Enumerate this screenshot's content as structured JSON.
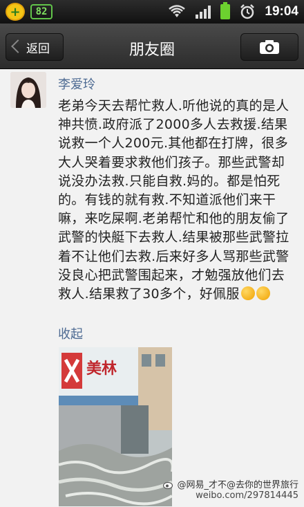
{
  "status_bar": {
    "battery_badge": "82",
    "time": "19:04"
  },
  "header": {
    "back_label": "返回",
    "title": "朋友圈"
  },
  "post": {
    "author": "李爱玲",
    "text": "老弟今天去帮忙救人.听他说的真的是人神共愤.政府派了2000多人去救援.结果说救一个人200元.其他都在打牌，很多大人哭着要求救他们孩子。那些武警却说没办法救.只能自救.妈的。都是怕死的。有钱的就有救.不知道派他们来干嘛，来吃屎啊.老弟帮忙和他的朋友偷了武警的快艇下去救人.结果被那些武警拉着不让他们去救.后来好多人骂那些武警没良心把武警围起来，才勉强放他们去救人.结果救了30多个，好佩服",
    "collapse_label": "收起",
    "photo_sign_text": "美林"
  },
  "watermark": {
    "line1": "@网易_才不@去你的世界旅行",
    "line2": "weibo.com/297814445"
  },
  "colors": {
    "link": "#4d6a92",
    "battery_green": "#6cd12f"
  }
}
